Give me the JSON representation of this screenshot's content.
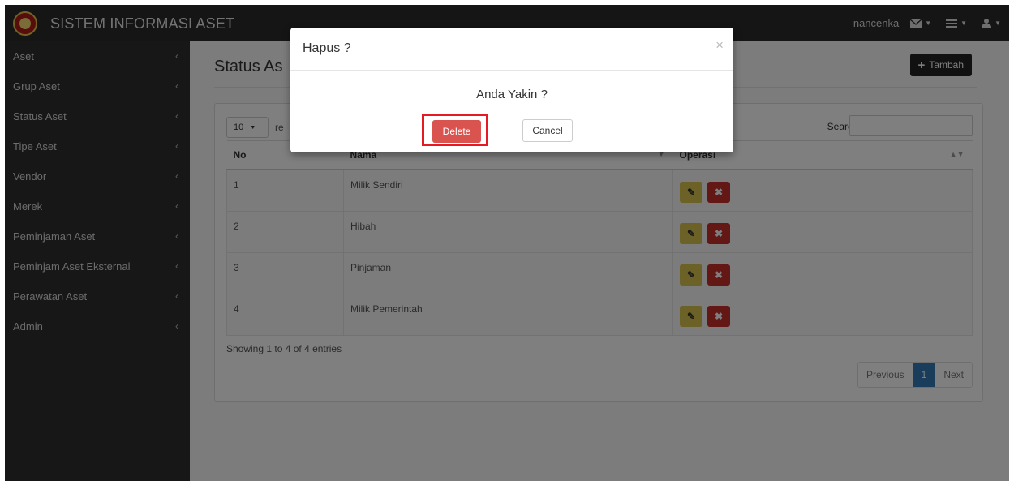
{
  "app": {
    "title": "SISTEM INFORMASI ASET"
  },
  "navbar": {
    "user": "nancenka",
    "icons": [
      "mail-icon",
      "tasks-icon",
      "user-icon"
    ]
  },
  "sidebar": {
    "items": [
      {
        "label": "Aset"
      },
      {
        "label": "Grup Aset"
      },
      {
        "label": "Status Aset"
      },
      {
        "label": "Tipe Aset"
      },
      {
        "label": "Vendor"
      },
      {
        "label": "Merek"
      },
      {
        "label": "Peminjaman Aset"
      },
      {
        "label": "Peminjam Aset Eksternal"
      },
      {
        "label": "Perawatan Aset"
      },
      {
        "label": "Admin"
      }
    ]
  },
  "page": {
    "title": "Status As",
    "add_label": "Tambah"
  },
  "datatable": {
    "length_value": "10",
    "length_suffix": "re",
    "search_label": "Search:",
    "search_value": "",
    "columns": [
      "No",
      "Nama",
      "Operasi"
    ],
    "rows": [
      {
        "no": "1",
        "nama": "Milik Sendiri"
      },
      {
        "no": "2",
        "nama": "Hibah"
      },
      {
        "no": "3",
        "nama": "Pinjaman"
      },
      {
        "no": "4",
        "nama": "Milik Pemerintah"
      }
    ],
    "info": "Showing 1 to 4 of 4 entries",
    "pagination": {
      "previous": "Previous",
      "current": "1",
      "next": "Next"
    }
  },
  "modal": {
    "title": "Hapus ?",
    "close": "×",
    "message": "Anda Yakin ?",
    "delete_label": "Delete",
    "cancel_label": "Cancel"
  },
  "colors": {
    "navbar": "#2a2a2a",
    "sidebar": "#2f2f2f",
    "delete_button": "#d9534f",
    "highlight": "#e41b23",
    "edit_button": "#d9c24c",
    "row_delete_button": "#c9302c",
    "pagination_active": "#337ab7"
  }
}
